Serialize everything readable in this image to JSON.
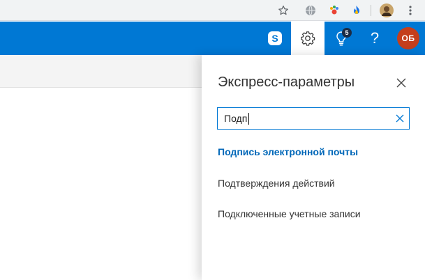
{
  "browser": {
    "icons": [
      "star-icon",
      "globe-extension-icon",
      "paw-extension-icon",
      "flame-extension-icon",
      "profile-avatar",
      "kebab-menu-icon"
    ]
  },
  "header": {
    "skype_label": "S",
    "notifications_badge": "5",
    "help_label": "?",
    "avatar_initials": "ОБ",
    "colors": {
      "bar": "#0078d4",
      "avatar": "#c43e1c"
    }
  },
  "panel": {
    "title": "Экспресс-параметры",
    "search": {
      "value": "Подп",
      "placeholder": ""
    },
    "results": [
      {
        "label": "Подпись электронной почты",
        "highlighted": true
      },
      {
        "label": "Подтверждения действий",
        "highlighted": false
      },
      {
        "label": "Подключенные учетные записи",
        "highlighted": false
      }
    ]
  }
}
